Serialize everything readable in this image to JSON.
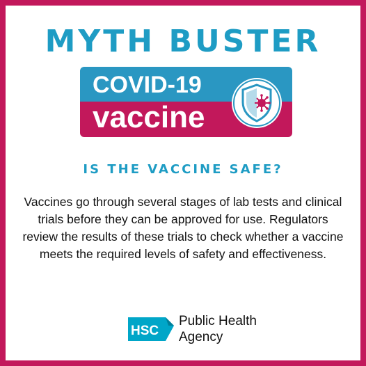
{
  "colors": {
    "border": "#C2185B",
    "accent": "#1E9CC4",
    "logo_top": "#2A97C2",
    "logo_bottom": "#C2185B",
    "hsc": "#00A6C8"
  },
  "header": {
    "title": "MYTH BUSTER"
  },
  "logo": {
    "line1": "COVID-19",
    "line2": "vaccine",
    "icon": "shield-virus-icon"
  },
  "content": {
    "question": "IS THE VACCINE SAFE?",
    "answer": "Vaccines go through several stages of lab tests and clinical trials before they can be approved for use. Regulators review the results of these trials to check whether a vaccine meets the required levels of safety and effectiveness."
  },
  "footer": {
    "org_abbrev": "HSC",
    "org_line1": "Public Health",
    "org_line2": "Agency"
  }
}
